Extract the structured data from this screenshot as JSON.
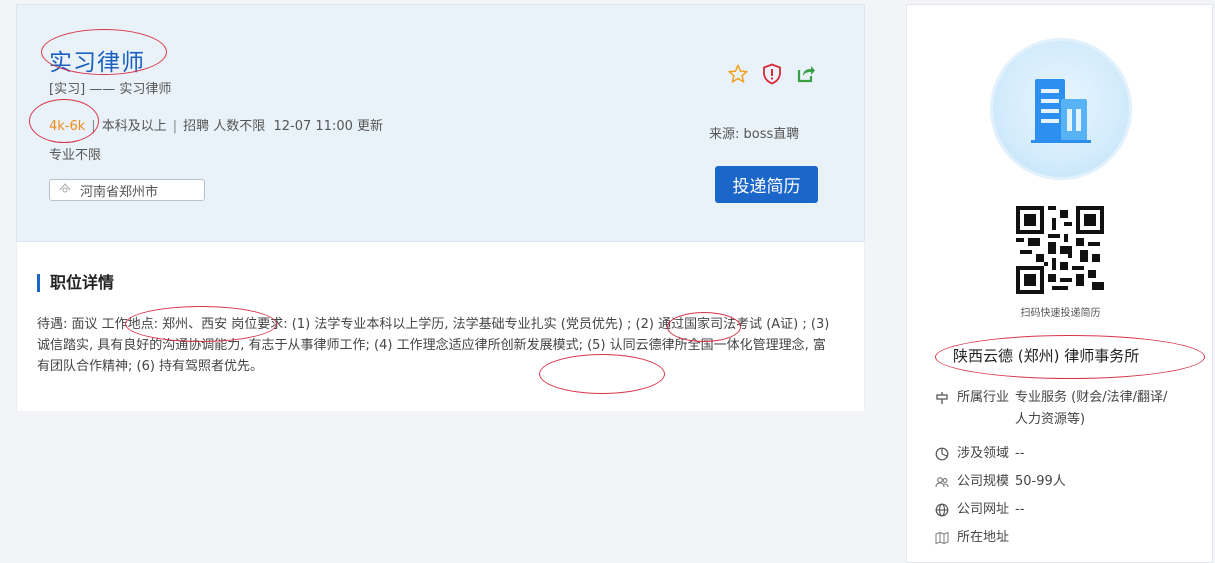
{
  "job": {
    "title": "实习律师",
    "subtitle": "[实习]  ——  实习律师",
    "salary": "4k-6k",
    "education": "本科及以上",
    "headcount": "招聘 人数不限",
    "updated": "12-07 11:00 更新",
    "major": "专业不限",
    "location": "河南省郑州市",
    "source": "来源:  boss直聘",
    "apply_label": "投递简历",
    "icons": [
      "star-icon",
      "report-shield-icon",
      "share-icon"
    ]
  },
  "detail": {
    "heading": "职位详情",
    "body_part1": "待遇: 面议 工作地点: 郑州、西安 岗位要求:  (1) 法学专业本科以上学历, 法学基础专业扎实 (党员优先) ;  (2) 通过国家司法考试 (A证) ;  (3) 诚信踏实, 具有良好的沟通协调能力, 有志于从事律师工作;  (4) 工作理念适应律所创新发展模式;  (5) 认同云德律所全国一体化管理理念, 富有团队合作精神;  (6) 持有驾照者优先。"
  },
  "company": {
    "qr_caption": "扫码快速投递简历",
    "name": "陕西云德 (郑州) 律师事务所",
    "industry_label": "所属行业",
    "industry_value": "专业服务 (财会/法律/翻译/人力资源等)",
    "field_label": "涉及领域",
    "field_value": "--",
    "size_label": "公司规模",
    "size_value": "50-99人",
    "website_label": "公司网址",
    "website_value": "--",
    "address_label": "所在地址",
    "address_value": ""
  },
  "colors": {
    "accent": "#1a66c9",
    "salary": "#f08a1c",
    "annotation": "#d9364a",
    "header_bg": "#eaf2f9"
  }
}
